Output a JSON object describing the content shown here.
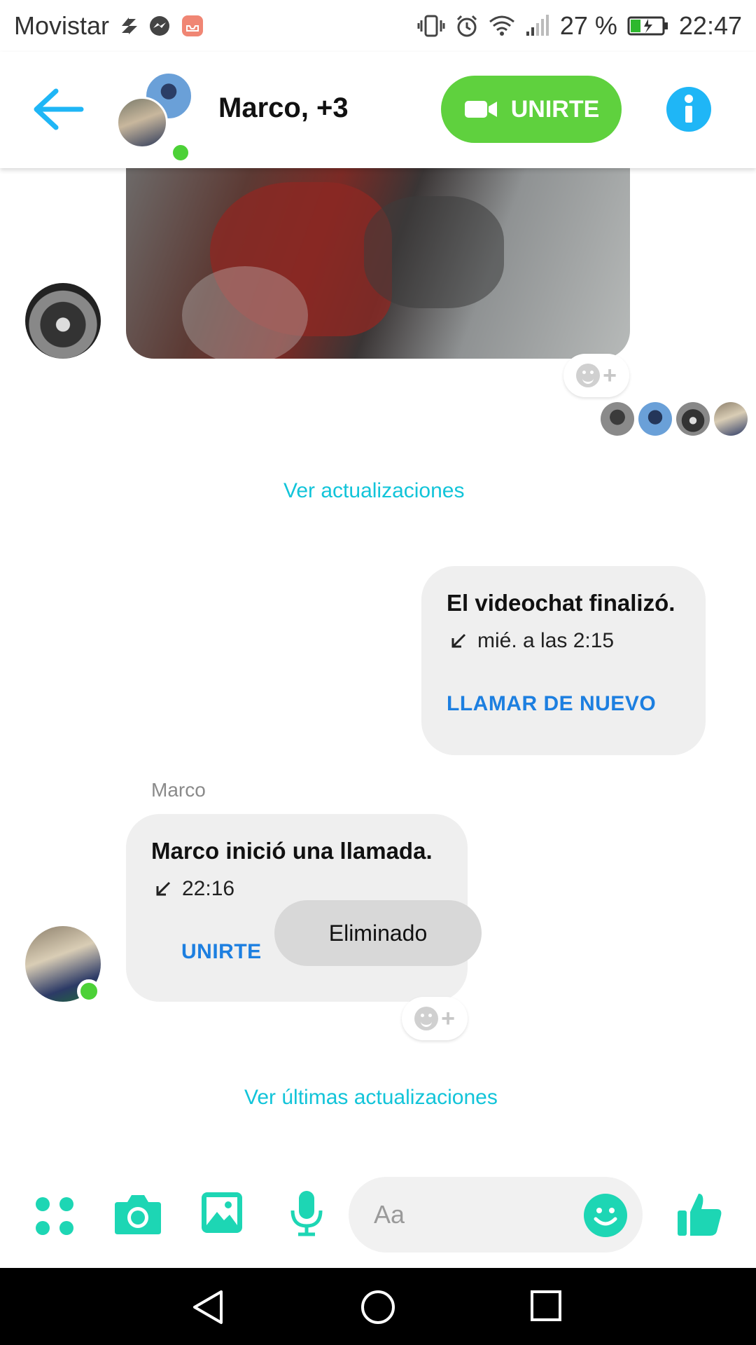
{
  "status_bar": {
    "carrier": "Movistar",
    "battery_percent": "27 %",
    "time": "22:47"
  },
  "header": {
    "title": "Marco, +3",
    "join_button_label": "UNIRTE",
    "online": true
  },
  "messages": {
    "see_updates_link": "Ver actualizaciones",
    "call_ended": {
      "title": "El videochat finalizó.",
      "time": "mié. a las 2:15",
      "action": "LLAMAR DE NUEVO"
    },
    "call_started": {
      "sender": "Marco",
      "title": "Marco inició una llamada.",
      "time": "22:16",
      "action": "UNIRTE"
    },
    "see_latest_link": "Ver últimas actualizaciones"
  },
  "toast": {
    "text": "Eliminado"
  },
  "composer": {
    "placeholder": "Aa"
  },
  "colors": {
    "accent_teal": "#1dd6b4",
    "link_cyan": "#12c4d9",
    "join_green": "#5fd13e",
    "info_blue": "#1fb6f6",
    "action_blue": "#1d7fe0"
  }
}
